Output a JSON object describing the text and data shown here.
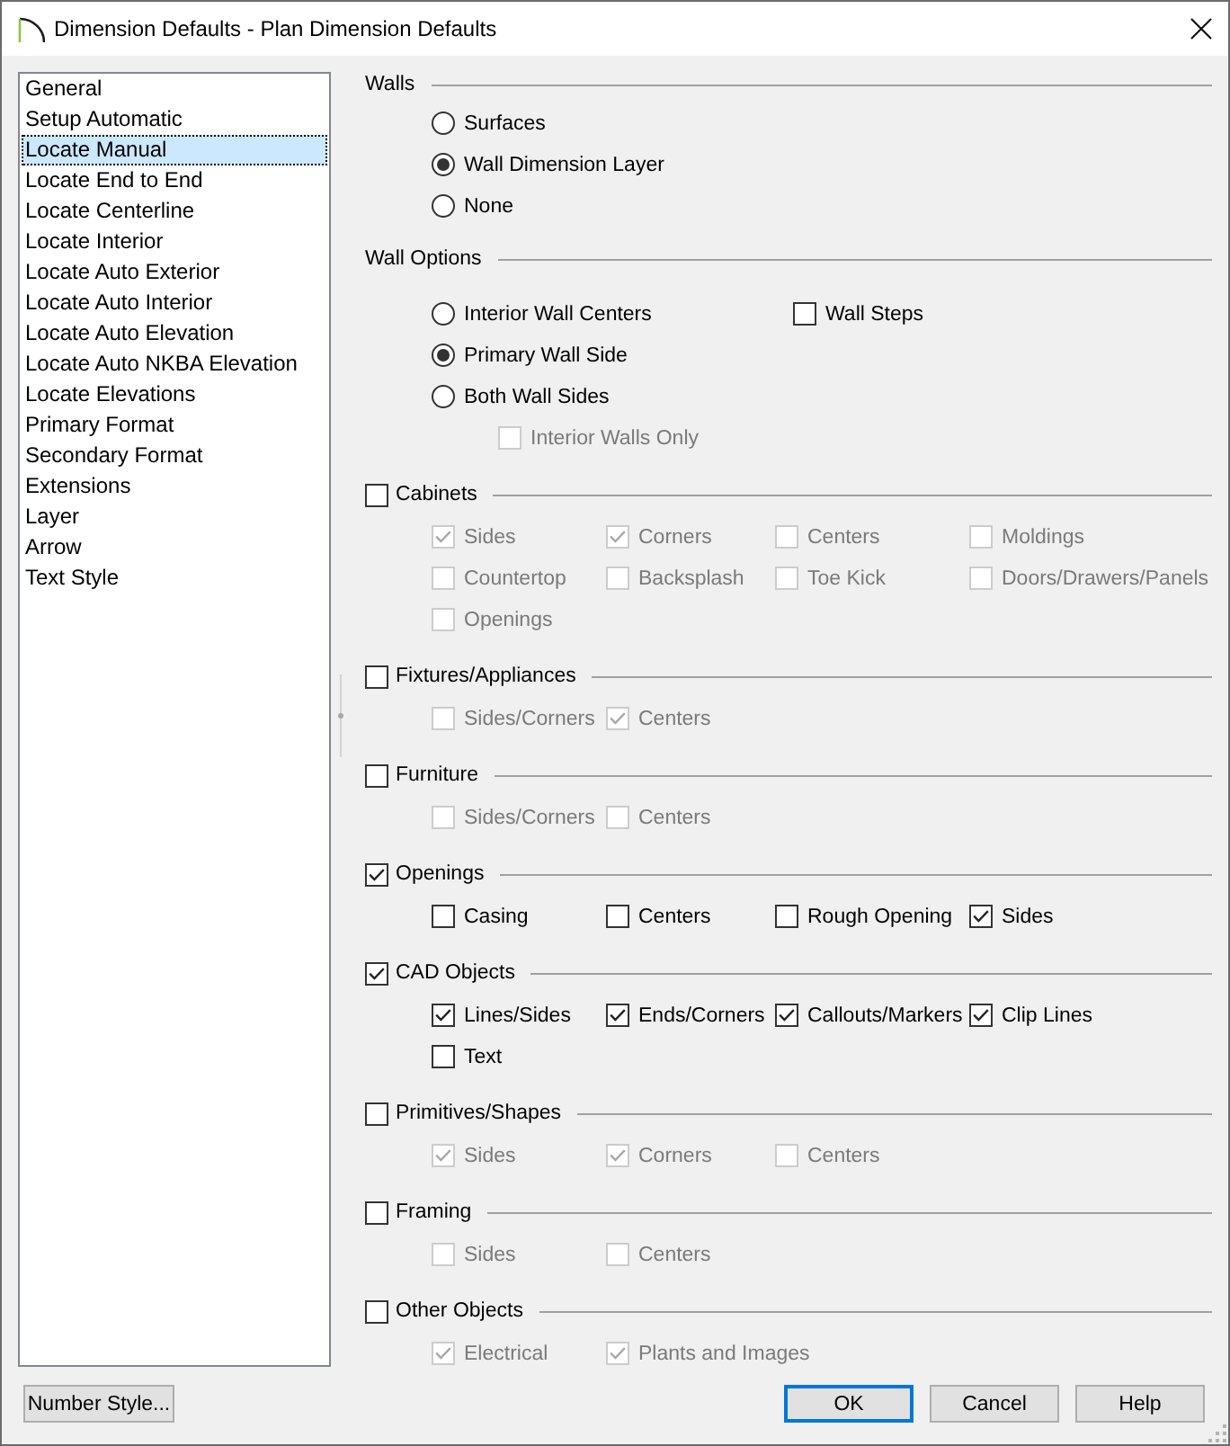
{
  "window": {
    "title": "Dimension Defaults - Plan Dimension Defaults"
  },
  "sidebar": {
    "items": [
      {
        "label": "General",
        "selected": false
      },
      {
        "label": "Setup Automatic",
        "selected": false
      },
      {
        "label": "Locate Manual",
        "selected": true
      },
      {
        "label": "Locate End to End",
        "selected": false
      },
      {
        "label": "Locate Centerline",
        "selected": false
      },
      {
        "label": "Locate Interior",
        "selected": false
      },
      {
        "label": "Locate Auto Exterior",
        "selected": false
      },
      {
        "label": "Locate Auto Interior",
        "selected": false
      },
      {
        "label": "Locate Auto Elevation",
        "selected": false
      },
      {
        "label": "Locate Auto NKBA Elevation",
        "selected": false
      },
      {
        "label": "Locate Elevations",
        "selected": false
      },
      {
        "label": "Primary Format",
        "selected": false
      },
      {
        "label": "Secondary Format",
        "selected": false
      },
      {
        "label": "Extensions",
        "selected": false
      },
      {
        "label": "Layer",
        "selected": false
      },
      {
        "label": "Arrow",
        "selected": false
      },
      {
        "label": "Text Style",
        "selected": false
      }
    ]
  },
  "sections": [
    {
      "kind": "options",
      "title": "Walls",
      "rows": [
        [
          {
            "kind": "radio",
            "label": "Surfaces",
            "selected": false
          }
        ],
        [
          {
            "kind": "radio",
            "label": "Wall Dimension Layer",
            "selected": true
          }
        ],
        [
          {
            "kind": "radio",
            "label": "None",
            "selected": false
          }
        ]
      ]
    },
    {
      "kind": "options",
      "title": "Wall Options",
      "rows": [
        [
          {
            "kind": "radio",
            "label": "Interior Wall Centers",
            "selected": false
          },
          {
            "kind": "checkbox",
            "label": "Wall Steps",
            "checked": false,
            "disabled": false
          }
        ],
        [
          {
            "kind": "radio",
            "label": "Primary Wall Side",
            "selected": true
          }
        ],
        [
          {
            "kind": "radio",
            "label": "Both Wall Sides",
            "selected": false,
            "children": [
              {
                "kind": "checkbox",
                "label": "Interior Walls Only",
                "checked": false,
                "disabled": true
              }
            ]
          }
        ]
      ]
    },
    {
      "kind": "objects",
      "title": "Cabinets",
      "checked": false,
      "rows": [
        [
          {
            "kind": "checkbox",
            "label": "Sides",
            "checked": true,
            "disabled": true
          },
          {
            "kind": "checkbox",
            "label": "Corners",
            "checked": true,
            "disabled": true
          },
          {
            "kind": "checkbox",
            "label": "Centers",
            "checked": false,
            "disabled": true
          },
          {
            "kind": "checkbox",
            "label": "Moldings",
            "checked": false,
            "disabled": true
          }
        ],
        [
          {
            "kind": "checkbox",
            "label": "Countertop",
            "checked": false,
            "disabled": true
          },
          {
            "kind": "checkbox",
            "label": "Backsplash",
            "checked": false,
            "disabled": true
          },
          {
            "kind": "checkbox",
            "label": "Toe Kick",
            "checked": false,
            "disabled": true
          },
          {
            "kind": "checkbox",
            "label": "Doors/Drawers/Panels",
            "checked": false,
            "disabled": true
          }
        ],
        [
          {
            "kind": "checkbox",
            "label": "Openings",
            "checked": false,
            "disabled": true
          }
        ]
      ]
    },
    {
      "kind": "objects",
      "title": "Fixtures/Appliances",
      "checked": false,
      "rows": [
        [
          {
            "kind": "checkbox",
            "label": "Sides/Corners",
            "checked": false,
            "disabled": true
          },
          {
            "kind": "checkbox",
            "label": "Centers",
            "checked": true,
            "disabled": true
          }
        ]
      ]
    },
    {
      "kind": "objects",
      "title": "Furniture",
      "checked": false,
      "rows": [
        [
          {
            "kind": "checkbox",
            "label": "Sides/Corners",
            "checked": false,
            "disabled": true
          },
          {
            "kind": "checkbox",
            "label": "Centers",
            "checked": false,
            "disabled": true
          }
        ]
      ]
    },
    {
      "kind": "objects",
      "title": "Openings",
      "checked": true,
      "rows": [
        [
          {
            "kind": "checkbox",
            "label": "Casing",
            "checked": false,
            "disabled": false
          },
          {
            "kind": "checkbox",
            "label": "Centers",
            "checked": false,
            "disabled": false
          },
          {
            "kind": "checkbox",
            "label": "Rough Opening",
            "checked": false,
            "disabled": false
          },
          {
            "kind": "checkbox",
            "label": "Sides",
            "checked": true,
            "disabled": false
          }
        ]
      ]
    },
    {
      "kind": "objects",
      "title": "CAD Objects",
      "checked": true,
      "rows": [
        [
          {
            "kind": "checkbox",
            "label": "Lines/Sides",
            "checked": true,
            "disabled": false
          },
          {
            "kind": "checkbox",
            "label": "Ends/Corners",
            "checked": true,
            "disabled": false
          },
          {
            "kind": "checkbox",
            "label": "Callouts/Markers",
            "checked": true,
            "disabled": false
          },
          {
            "kind": "checkbox",
            "label": "Clip Lines",
            "checked": true,
            "disabled": false
          }
        ],
        [
          {
            "kind": "checkbox",
            "label": "Text",
            "checked": false,
            "disabled": false
          }
        ]
      ]
    },
    {
      "kind": "objects",
      "title": "Primitives/Shapes",
      "checked": false,
      "rows": [
        [
          {
            "kind": "checkbox",
            "label": "Sides",
            "checked": true,
            "disabled": true
          },
          {
            "kind": "checkbox",
            "label": "Corners",
            "checked": true,
            "disabled": true
          },
          {
            "kind": "checkbox",
            "label": "Centers",
            "checked": false,
            "disabled": true
          }
        ]
      ]
    },
    {
      "kind": "objects",
      "title": "Framing",
      "checked": false,
      "rows": [
        [
          {
            "kind": "checkbox",
            "label": "Sides",
            "checked": false,
            "disabled": true
          },
          {
            "kind": "checkbox",
            "label": "Centers",
            "checked": false,
            "disabled": true
          }
        ]
      ]
    },
    {
      "kind": "objects",
      "title": "Other Objects",
      "checked": false,
      "rows": [
        [
          {
            "kind": "checkbox",
            "label": "Electrical",
            "checked": true,
            "disabled": true
          },
          {
            "kind": "checkbox",
            "label": "Plants and Images",
            "checked": true,
            "disabled": true
          }
        ]
      ]
    }
  ],
  "footer": {
    "number_style_button": {
      "label": "Number Style..."
    },
    "buttons": [
      {
        "label": "OK",
        "default": true
      },
      {
        "label": "Cancel",
        "default": false
      },
      {
        "label": "Help",
        "default": false
      }
    ]
  }
}
